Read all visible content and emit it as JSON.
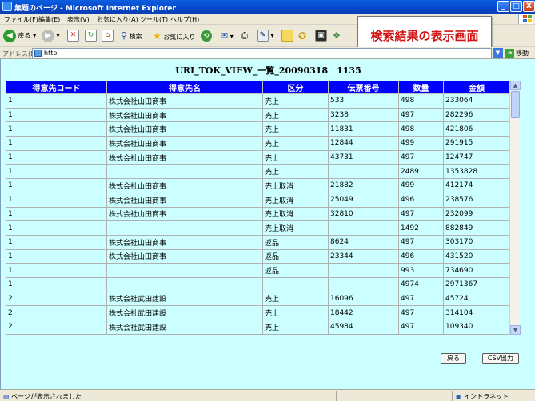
{
  "window": {
    "title": "無題のページ - Microsoft Internet Explorer",
    "min_label": "_",
    "max_label": "□",
    "close_label": "X"
  },
  "menu": [
    "ファイル(F)",
    "編集(E)",
    "表示(V)",
    "お気に入り(A)",
    "ツール(T)",
    "ヘルプ(H)"
  ],
  "toolbar": {
    "back_label": "戻る",
    "search_label": "検索",
    "favorites_label": "お気に入り"
  },
  "callout": "検索結果の表示画面",
  "address": {
    "label": "アドレス(D)",
    "value": "http",
    "go_label": "移動"
  },
  "page": {
    "title": "URI_TOK_VIEW_一覧_20090318　1135",
    "columns": [
      "得意先コード",
      "得意先名",
      "区分",
      "伝票番号",
      "数量",
      "金額"
    ],
    "rows": [
      [
        "1",
        "株式会社山田商事",
        "売上",
        "533",
        "498",
        "233064"
      ],
      [
        "1",
        "株式会社山田商事",
        "売上",
        "3238",
        "497",
        "282296"
      ],
      [
        "1",
        "株式会社山田商事",
        "売上",
        "11831",
        "498",
        "421806"
      ],
      [
        "1",
        "株式会社山田商事",
        "売上",
        "12844",
        "499",
        "291915"
      ],
      [
        "1",
        "株式会社山田商事",
        "売上",
        "43731",
        "497",
        "124747"
      ],
      [
        "1",
        "",
        "売上",
        "",
        "2489",
        "1353828"
      ],
      [
        "1",
        "株式会社山田商事",
        "売上取消",
        "21882",
        "499",
        "412174"
      ],
      [
        "1",
        "株式会社山田商事",
        "売上取消",
        "25049",
        "496",
        "238576"
      ],
      [
        "1",
        "株式会社山田商事",
        "売上取消",
        "32810",
        "497",
        "232099"
      ],
      [
        "1",
        "",
        "売上取消",
        "",
        "1492",
        "882849"
      ],
      [
        "1",
        "株式会社山田商事",
        "返品",
        "8624",
        "497",
        "303170"
      ],
      [
        "1",
        "株式会社山田商事",
        "返品",
        "23344",
        "496",
        "431520"
      ],
      [
        "1",
        "",
        "返品",
        "",
        "993",
        "734690"
      ],
      [
        "1",
        "",
        "",
        "",
        "4974",
        "2971367"
      ],
      [
        "2",
        "株式会社武田建設",
        "売上",
        "16096",
        "497",
        "45724"
      ],
      [
        "2",
        "株式会社武田建設",
        "売上",
        "18442",
        "497",
        "314104"
      ],
      [
        "2",
        "株式会社武田建設",
        "売上",
        "45984",
        "497",
        "109340"
      ]
    ],
    "back_button": "戻る",
    "csv_button": "CSV出力"
  },
  "status": {
    "message": "ページが表示されました",
    "zone": "イントラネット"
  }
}
